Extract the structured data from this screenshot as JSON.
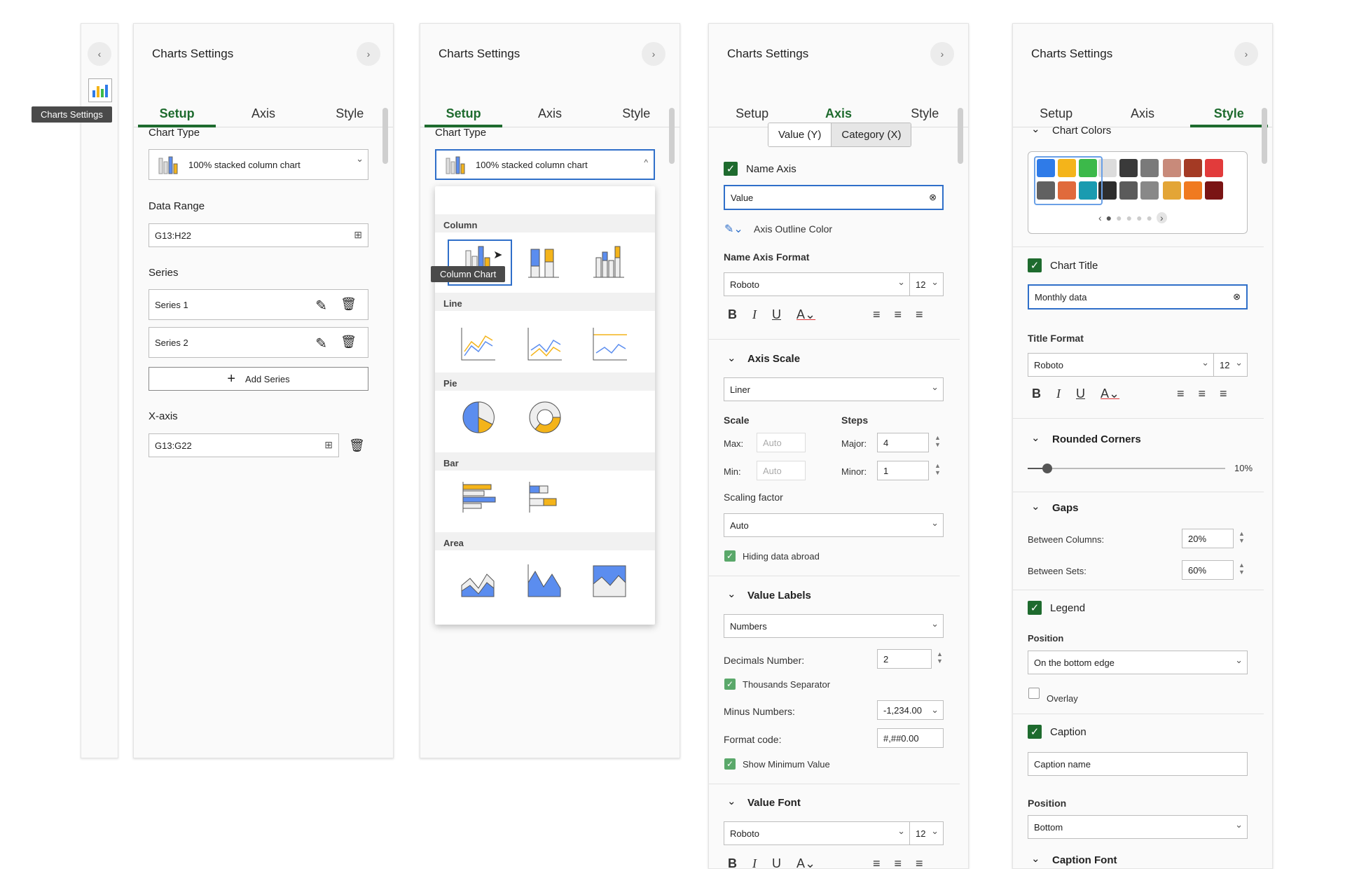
{
  "rail": {
    "tooltip": "Charts Settings",
    "collapse_glyph": "‹"
  },
  "panel_title": "Charts Settings",
  "tabs": [
    "Setup",
    "Axis",
    "Style"
  ],
  "setup": {
    "chart_type_label": "Chart Type",
    "chart_type_value": "100% stacked column chart",
    "data_range_label": "Data Range",
    "data_range_value": "G13:H22",
    "series_label": "Series",
    "series": [
      "Series 1",
      "Series 2"
    ],
    "add_series": "Add Series",
    "xaxis_label": "X-axis",
    "xaxis_value": "G13:G22"
  },
  "dropdown": {
    "groups": [
      "Column",
      "Line",
      "Pie",
      "Bar",
      "Area"
    ],
    "tooltip": "Column Chart"
  },
  "axis": {
    "toggle": [
      "Value (Y)",
      "Category (X)"
    ],
    "name_axis_label": "Name Axis",
    "name_axis_value": "Value",
    "outline_color": "Axis Outline Color",
    "name_axis_format": "Name Axis Format",
    "font": "Roboto",
    "size": "12",
    "axis_scale": "Axis Scale",
    "scale_type": "Liner",
    "scale": "Scale",
    "steps": "Steps",
    "max": "Max:",
    "min": "Min:",
    "auto": "Auto",
    "major": "Major:",
    "major_value": "4",
    "minor": "Minor:",
    "minor_value": "1",
    "scaling_factor": "Scaling factor",
    "scaling_value": "Auto",
    "hiding": "Hiding data abroad",
    "value_labels": "Value Labels",
    "labels_type": "Numbers",
    "decimals": "Decimals Number:",
    "decimals_value": "2",
    "thousands": "Thousands Separator",
    "minus": "Minus Numbers:",
    "minus_value": "-1,234.00",
    "format_code": "Format code:",
    "format_value": "#,##0.00",
    "show_min": "Show Minimum Value",
    "value_font": "Value Font"
  },
  "style": {
    "chart_colors": "Chart Colors",
    "palette": [
      [
        "#2f7be8",
        "#f4b41a",
        "#3cb94a"
      ],
      [
        "#616161",
        "#e06a3c",
        "#1a9bb0"
      ],
      [
        "#dcdcdc",
        "#3a3a3a",
        "#7a7a7a"
      ],
      [
        "#2e2e2e",
        "#5b5b5b",
        "#888888"
      ],
      [
        "#c88a7a",
        "#a43a24",
        "#e23b3b"
      ],
      [
        "#e3a536",
        "#f07a20",
        "#7a1414"
      ]
    ],
    "chart_title": "Chart Title",
    "title_value": "Monthly data",
    "title_format": "Title Format",
    "font": "Roboto",
    "size": "12",
    "rounded": "Rounded Corners",
    "rounded_value": "10%",
    "rounded_fraction": 0.1,
    "gaps": "Gaps",
    "between_columns": "Between Columns:",
    "bc_value": "20%",
    "between_sets": "Between Sets:",
    "bs_value": "60%",
    "legend": "Legend",
    "position": "Position",
    "legend_position": "On the bottom edge",
    "overlay": "Overlay",
    "caption": "Caption",
    "caption_placeholder": "Caption name",
    "caption_position": "Bottom",
    "caption_font": "Caption Font"
  },
  "colors": {
    "accent": "#1e6b2e",
    "focus": "#2f6fc9",
    "chart_blue": "#5b8def",
    "chart_yellow": "#f4b41a"
  }
}
